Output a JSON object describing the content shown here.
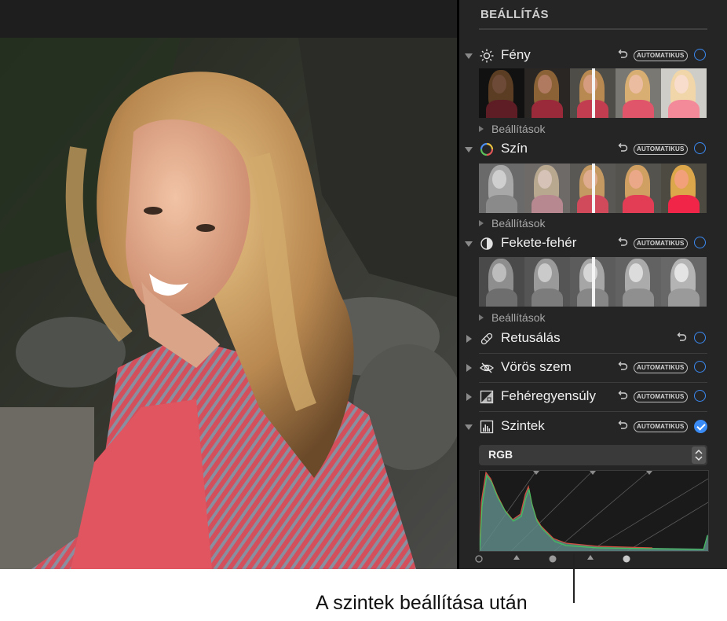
{
  "panel": {
    "title": "BEÁLLÍTÁS",
    "sections": [
      {
        "label": "Fény",
        "auto_label": "AUTOMATIKUS",
        "sub_label": "Beállítások",
        "expanded": true,
        "icon": "sun-icon"
      },
      {
        "label": "Szín",
        "auto_label": "AUTOMATIKUS",
        "sub_label": "Beállítások",
        "expanded": true,
        "icon": "color-wheel-icon"
      },
      {
        "label": "Fekete-fehér",
        "auto_label": "AUTOMATIKUS",
        "sub_label": "Beállítások",
        "expanded": true,
        "icon": "half-circle-icon"
      },
      {
        "label": "Retusálás",
        "expanded": false,
        "icon": "bandage-icon"
      },
      {
        "label": "Vörös szem",
        "auto_label": "AUTOMATIKUS",
        "expanded": false,
        "icon": "eye-slash-icon"
      },
      {
        "label": "Fehéregyensúly",
        "auto_label": "AUTOMATIKUS",
        "expanded": false,
        "icon": "white-balance-icon"
      },
      {
        "label": "Szintek",
        "auto_label": "AUTOMATIKUS",
        "expanded": true,
        "enabled": true,
        "icon": "levels-icon"
      }
    ],
    "levels": {
      "channel_value": "RGB"
    }
  },
  "caption": "A szintek beállítása után",
  "colors": {
    "accent": "#3b8bf5",
    "panel_bg": "#252525",
    "photo_shirt": "#e0555f"
  }
}
